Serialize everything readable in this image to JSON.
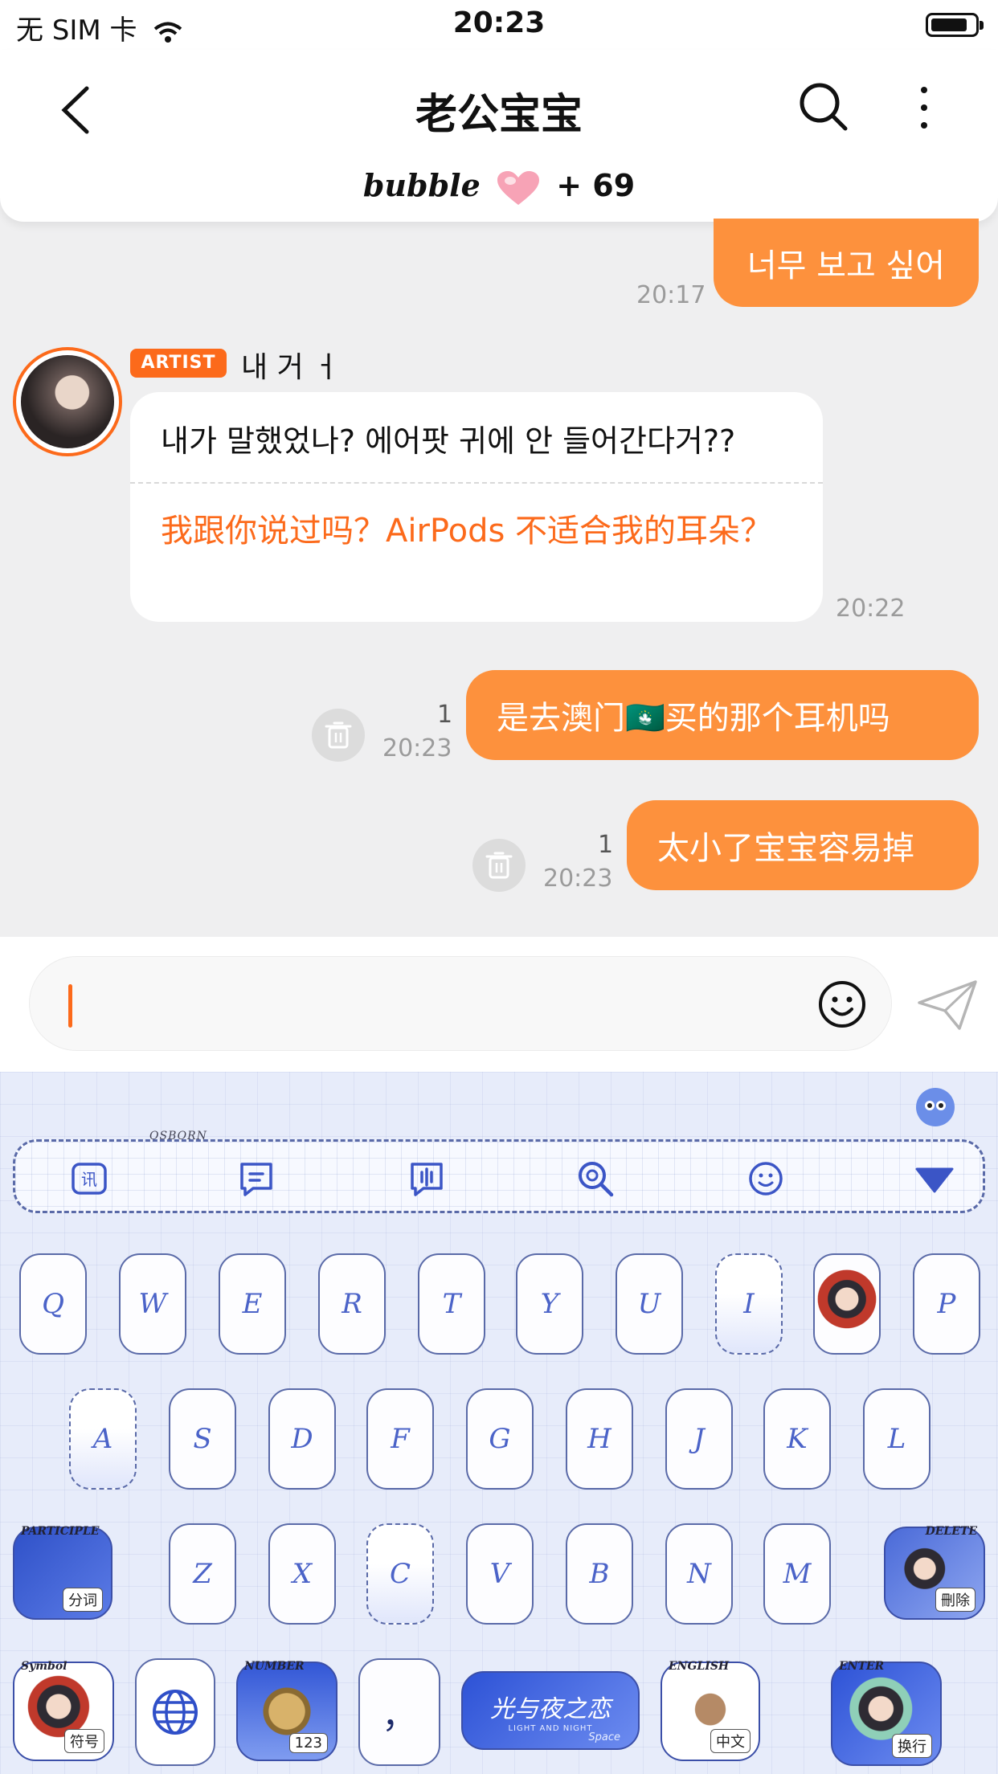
{
  "status_bar": {
    "carrier": "无 SIM 卡",
    "time": "20:23"
  },
  "header": {
    "title": "老公宝宝",
    "bubble_brand": "bubble",
    "bubble_count": "+ 69"
  },
  "messages": {
    "m1": {
      "text": "너무 보고 싶어",
      "time": "20:17"
    },
    "artist": {
      "badge": "ARTIST",
      "name": "내 거 ㅓ",
      "text": "내가 말했었나? 에어팟 귀에 안 들어간다거??",
      "translation": "我跟你说过吗？AirPods 不适合我的耳朵？",
      "time": "20:22"
    },
    "m3": {
      "text": "是去澳门🇲🇴买的那个耳机吗",
      "read": "1",
      "time": "20:23"
    },
    "m4": {
      "text": "太小了宝宝容易掉",
      "read": "1",
      "time": "20:23"
    }
  },
  "keyboard": {
    "toolbar_tag": "OSBORN",
    "row1": [
      "Q",
      "W",
      "E",
      "R",
      "T",
      "Y",
      "U",
      "I",
      "",
      "P"
    ],
    "row2": [
      "A",
      "S",
      "D",
      "F",
      "G",
      "H",
      "J",
      "K",
      "L"
    ],
    "row3": [
      "Z",
      "X",
      "C",
      "V",
      "B",
      "N",
      "M"
    ],
    "participle": {
      "tag": "PARTICIPLE",
      "label": "分词"
    },
    "delete": {
      "tag": "DELETE",
      "label": "刪除"
    },
    "symbol": {
      "tag": "Symbol",
      "label": "符号"
    },
    "number": {
      "tag": "NUMBER",
      "label": "123"
    },
    "comma": "，",
    "space_brand": "光与夜之恋",
    "space_sub": "LIGHT AND NIGHT",
    "space_label": "Space",
    "english": {
      "tag": "ENGLISH",
      "label": "中文"
    },
    "enter": {
      "tag": "ENTER",
      "label": "换行"
    }
  },
  "colors": {
    "accent": "#fd913d",
    "artist": "#fc6a1b",
    "keyboard_blue": "#4b63c8"
  }
}
